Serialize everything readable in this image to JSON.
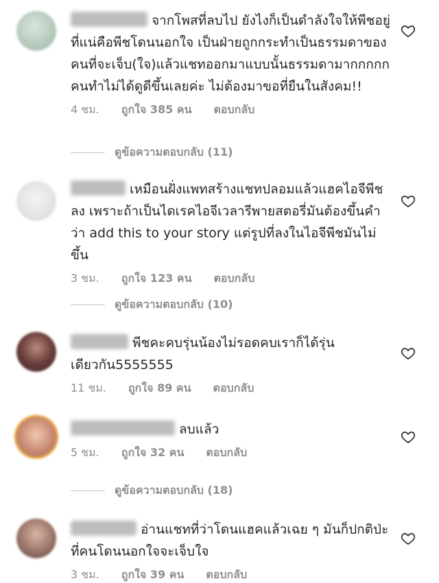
{
  "comments": [
    {
      "user": "username",
      "text": "จากโพสที่ลบไป ยังไงก็เป็นดำลังใจให้พีชอยู่ ที่แน่คือพีชโดนนอกใจ เป็นฝ่ายถูกกระทำเป็นธรรมดาของคนที่จะเจ็บ(ใจ)แล้วแชทออกมาแบบนั้นธรรมดามากกกกก คนทำไม่ได้ดูดีขึ้นเลยค่ะ ไม่ต้องมาขอที่ยืนในสังคม!!",
      "time": "4 ชม.",
      "likes": "ถูกใจ 385 คน",
      "reply": "ตอบกลับ",
      "view_replies": "ดูข้อความตอบกลับ (11)"
    },
    {
      "user": "username",
      "text": "เหมือนฝั่งแพทสร้างแชทปลอมแล้วแฮคไอจีพีชลง เพราะถ้าเป็นไดเรคไอจีเวลารีพายสตอรี่มันต้องขึ้นคำว่า add this to your story แต่รูปที่ลงในไอจีพีชมันไม่ขึ้น",
      "time": "3 ชม.",
      "likes": "ถูกใจ 123 คน",
      "reply": "ตอบกลับ",
      "view_replies": "ดูข้อความตอบกลับ (10)"
    },
    {
      "user": "username",
      "text": "พีชคะคบรุ่นน้องไม่รอดคบเราก็ได้รุ่นเดียวกัน5555555",
      "time": "11 ชม.",
      "likes": "ถูกใจ 89 คน",
      "reply": "ตอบกลับ"
    },
    {
      "user": "username",
      "text": "ลบแล้ว",
      "time": "5 ชม.",
      "likes": "ถูกใจ 32 คน",
      "reply": "ตอบกลับ",
      "view_replies": "ดูข้อความตอบกลับ (18)"
    },
    {
      "user": "username",
      "text": "อ่านแชทที่ว่าโดนแฮคแล้วเฉย ๆ มันก็ปกติป่ะ ที่คนโดนนอกใจจะเจ็บใจ",
      "time": "3 ชม.",
      "likes": "ถูกใจ 39 คน",
      "reply": "ตอบกลับ"
    }
  ],
  "icons": {
    "like": "heart-outline-icon"
  },
  "colors": {
    "text": "#262626",
    "meta": "#8e8e8e",
    "story_ring": "#e9a23b"
  }
}
